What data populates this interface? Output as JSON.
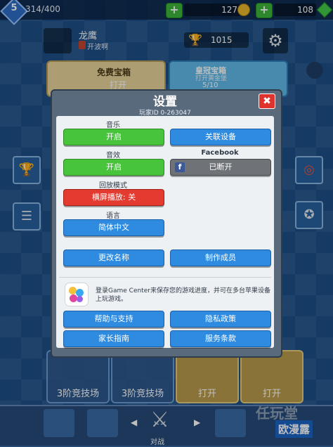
{
  "topbar": {
    "level": "5",
    "xp": "314/400",
    "gold": "127",
    "gems": "108",
    "plus": "+"
  },
  "profile": {
    "name": "龙鹰",
    "clan": "开波啊",
    "trophies": "1015"
  },
  "chests": {
    "free_title": "免费宝箱",
    "free_action": "打开",
    "crown_title": "皇冠宝箱",
    "crown_sub": "打开黄金堡",
    "crown_progress": "5/10"
  },
  "bottom_slots": [
    {
      "label": "3阶竞技场"
    },
    {
      "label": "3阶竞技场"
    },
    {
      "label": "打开"
    },
    {
      "label": "打开"
    }
  ],
  "nav": {
    "battle_label": "对战"
  },
  "watermark": {
    "text1": "任玩堂",
    "text2": "欧漫露"
  },
  "settings": {
    "title": "设置",
    "close": "✖",
    "player_id": "玩家ID   0-263047",
    "music_label": "音乐",
    "music_btn": "开启",
    "sfx_label": "音效",
    "sfx_btn": "开启",
    "link_device_btn": "关联设备",
    "facebook_label": "Facebook",
    "facebook_btn": "已断开",
    "replay_label": "回放模式",
    "replay_btn": "横屏播放: 关",
    "language_label": "语言",
    "language_btn": "简体中文",
    "rename_btn": "更改名称",
    "credits_btn": "制作成员",
    "gamecenter_text": "登录Game Center来保存您的游戏进度，并可在多台苹果设备上玩游戏。",
    "help_btn": "帮助与支持",
    "privacy_btn": "隐私政策",
    "parents_btn": "家长指南",
    "tos_btn": "服务条款"
  }
}
